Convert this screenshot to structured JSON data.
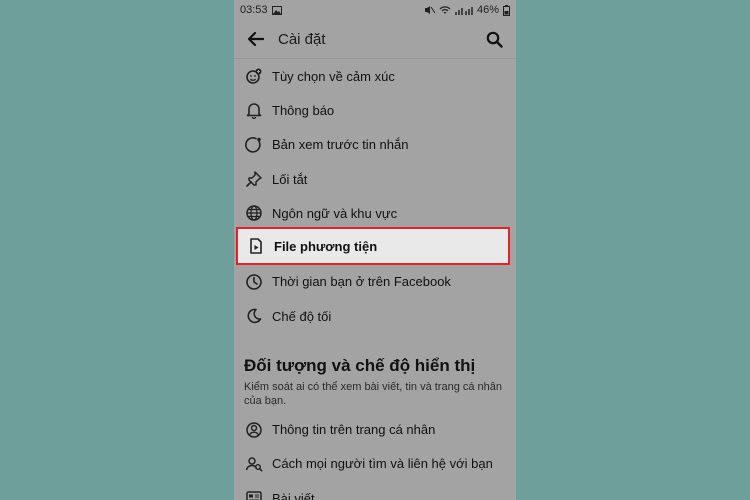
{
  "status_bar": {
    "time": "03:53",
    "battery": "46%"
  },
  "app_bar": {
    "title": "Cài đặt"
  },
  "settings_items": [
    {
      "label": "Tùy chọn về cảm xúc",
      "icon": "emoji-reaction-icon"
    },
    {
      "label": "Thông báo",
      "icon": "bell-icon"
    },
    {
      "label": "Bản xem trước tin nhắn",
      "icon": "message-preview-icon"
    },
    {
      "label": "Lối tắt",
      "icon": "pin-icon"
    },
    {
      "label": "Ngôn ngữ và khu vực",
      "icon": "globe-icon"
    },
    {
      "label": "File phương tiện",
      "icon": "media-file-icon",
      "highlighted": true
    },
    {
      "label": "Thời gian bạn ở trên Facebook",
      "icon": "clock-icon"
    },
    {
      "label": "Chế độ tối",
      "icon": "moon-icon"
    }
  ],
  "audience_section": {
    "title": "Đối tượng và chế độ hiển thị",
    "description": "Kiểm soát ai có thể xem bài viết, tin và trang cá nhân của bạn.",
    "items": [
      {
        "label": "Thông tin trên trang cá nhân",
        "icon": "profile-icon"
      },
      {
        "label": "Cách mọi người tìm và liên hệ với bạn",
        "icon": "find-people-icon"
      },
      {
        "label": "Bài viết",
        "icon": "posts-icon"
      }
    ]
  },
  "colors": {
    "background": "#6f9f9b",
    "highlight_border": "#e3232b"
  }
}
